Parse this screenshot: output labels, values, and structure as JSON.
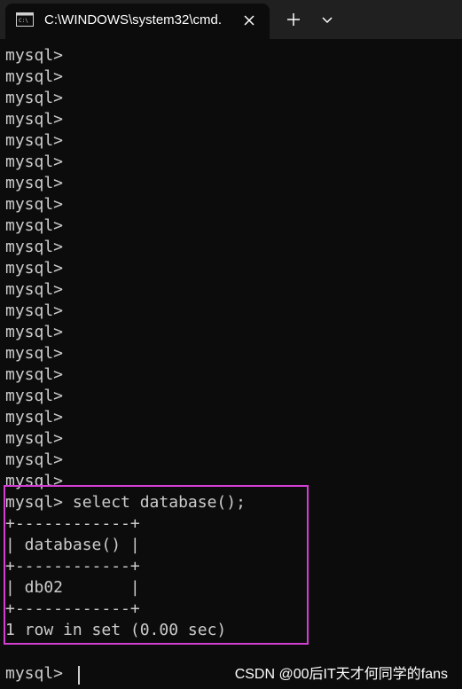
{
  "titlebar": {
    "tab_title": "C:\\WINDOWS\\system32\\cmd.",
    "icons": {
      "tab": "cmd-icon",
      "close": "close-icon",
      "new_tab": "plus-icon",
      "dropdown": "chevron-down-icon"
    }
  },
  "terminal": {
    "lines": [
      "mysql>",
      "mysql>",
      "mysql>",
      "mysql>",
      "mysql>",
      "mysql>",
      "mysql>",
      "mysql>",
      "mysql>",
      "mysql>",
      "mysql>",
      "mysql>",
      "mysql>",
      "mysql>",
      "mysql>",
      "mysql>",
      "mysql>",
      "mysql>",
      "mysql>",
      "mysql>",
      "mysql>",
      "mysql> select database();",
      "+------------+",
      "| database() |",
      "+------------+",
      "| db02       |",
      "+------------+",
      "1 row in set (0.00 sec)"
    ],
    "last_prompt": "mysql> "
  },
  "watermark": "CSDN @00后IT天才何同学的fans",
  "colors": {
    "background": "#0c0c0c",
    "titlebar": "#202020",
    "text": "#cccccc",
    "highlight_border": "#d23fd2"
  }
}
